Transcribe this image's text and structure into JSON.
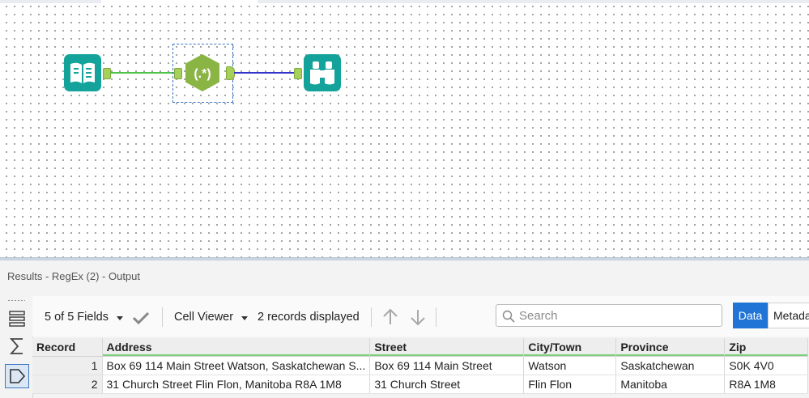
{
  "canvas": {
    "tools": [
      {
        "name": "Input Data",
        "icon": "book-icon",
        "color": "#13a39a"
      },
      {
        "name": "RegEx",
        "icon": "regex-icon",
        "label": "(.*)",
        "color": "#8ab443",
        "selected": true
      },
      {
        "name": "Browse",
        "icon": "binoculars-icon",
        "color": "#13a39a"
      }
    ],
    "connection_colors": {
      "first": "#4fc24a",
      "second": "#3336c9"
    }
  },
  "results": {
    "title": "Results - RegEx (2) - Output",
    "toolbar": {
      "fields_label": "5 of 5 Fields",
      "cell_viewer_label": "Cell Viewer",
      "records_label": "2 records displayed",
      "search_placeholder": "Search",
      "tab_data": "Data",
      "tab_metadata": "Metadata"
    },
    "table": {
      "columns": [
        "Record",
        "Address",
        "Street",
        "City/Town",
        "Province",
        "Zip"
      ],
      "rows": [
        [
          "1",
          "Box 69 114 Main Street Watson, Saskatchewan S...",
          "Box 69 114 Main Street",
          "Watson",
          "Saskatchewan",
          "S0K 4V0"
        ],
        [
          "2",
          "31 Church Street Flin Flon, Manitoba R8A 1M8",
          "31 Church Street",
          "Flin Flon",
          "Manitoba",
          "R8A 1M8"
        ]
      ]
    }
  },
  "colors": {
    "accent": "#1f74d6",
    "header_bar": "#7fd07a"
  }
}
